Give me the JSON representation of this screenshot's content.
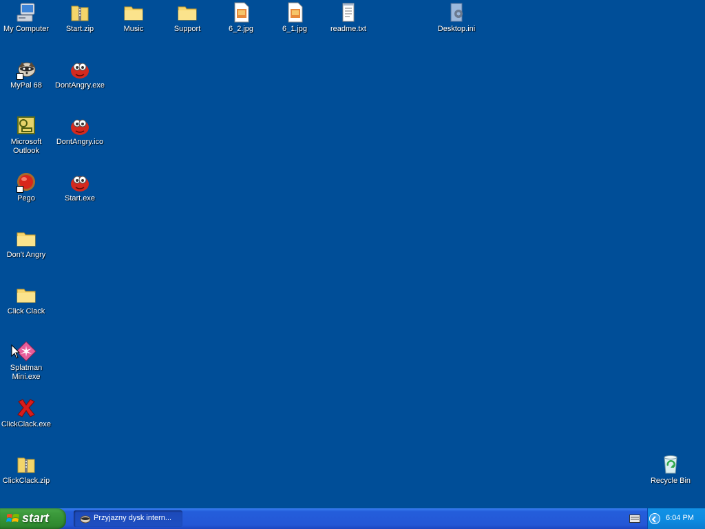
{
  "desktop": {
    "icons": [
      {
        "label": "My Computer",
        "icon": "my-computer-icon"
      },
      {
        "label": "Start.zip",
        "icon": "zip-folder-icon"
      },
      {
        "label": "Music",
        "icon": "folder-icon"
      },
      {
        "label": "Support",
        "icon": "folder-icon"
      },
      {
        "label": "6_2.jpg",
        "icon": "image-file-icon"
      },
      {
        "label": "6_1.jpg",
        "icon": "image-file-icon"
      },
      {
        "label": "readme.txt",
        "icon": "text-file-icon"
      },
      {
        "label": "Desktop.ini",
        "icon": "config-file-icon"
      },
      {
        "label": "MyPal 68",
        "icon": "raccoon-browser-icon"
      },
      {
        "label": "DontAngry.exe",
        "icon": "red-ball-creature-icon"
      },
      {
        "label": "Microsoft Outlook",
        "icon": "outlook-icon"
      },
      {
        "label": "DontAngry.ico",
        "icon": "red-ball-creature-icon"
      },
      {
        "label": "Pego",
        "icon": "red-orb-icon"
      },
      {
        "label": "Start.exe",
        "icon": "red-ball-creature-icon"
      },
      {
        "label": "Don't Angry",
        "icon": "folder-icon"
      },
      {
        "label": "Click Clack",
        "icon": "folder-icon"
      },
      {
        "label": "Splatman Mini.exe",
        "icon": "splatman-icon"
      },
      {
        "label": "ClickClack.exe",
        "icon": "red-x-icon"
      },
      {
        "label": "ClickClack.zip",
        "icon": "zip-folder-icon"
      },
      {
        "label": "Recycle Bin",
        "icon": "recycle-bin-icon"
      }
    ]
  },
  "taskbar": {
    "start_label": "start",
    "task_label": "Przyjazny dysk intern...",
    "clock": "6:04 PM"
  },
  "colors": {
    "desktop_background": "#004e98",
    "start_green": "#3c9a3c",
    "taskbar_blue": "#245edb",
    "tray_blue": "#0d8ae0"
  }
}
